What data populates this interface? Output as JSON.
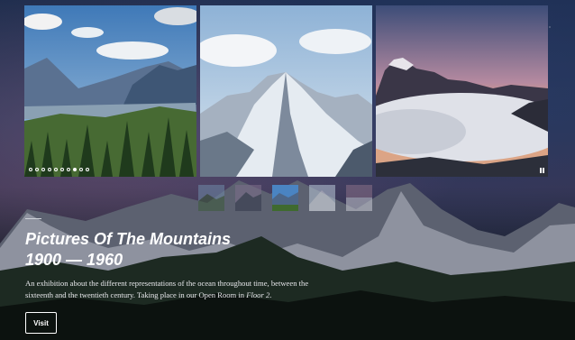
{
  "gallery": {
    "slides": [
      {
        "icon": "mountain-valley-forest-image"
      },
      {
        "icon": "snowy-peak-image"
      },
      {
        "icon": "sea-of-clouds-sunset-image"
      }
    ],
    "dots_total": 10,
    "dots_active_index": 7,
    "thumbnails_total": 5,
    "thumbnail_active_index": 2
  },
  "exhibit": {
    "title_line1": "Pictures Of The Mountains",
    "title_line2": "1900 — 1960",
    "description_main": "An exhibition about the different representations of the ocean throughout time, between the sixteenth and the twentieth century. Taking place in our Open Room in ",
    "description_floor": "Floor 2",
    "description_end": ".",
    "visit_label": "Visit"
  }
}
